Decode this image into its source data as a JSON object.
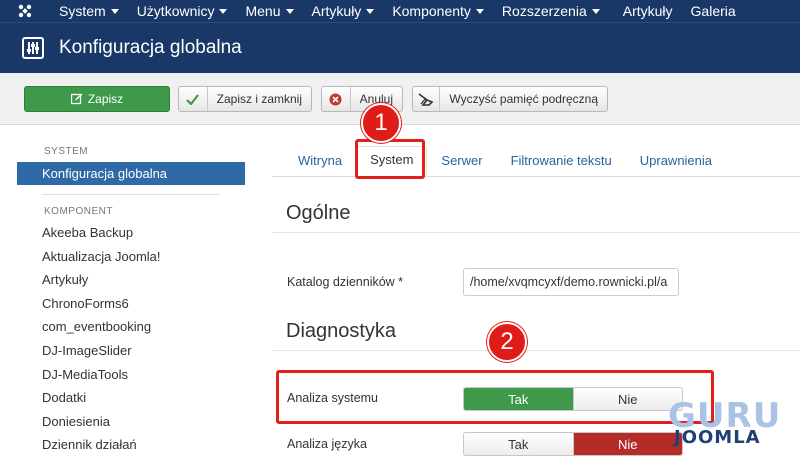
{
  "topnav": {
    "items": [
      {
        "label": "System",
        "caret": true
      },
      {
        "label": "Użytkownicy",
        "caret": true
      },
      {
        "label": "Menu",
        "caret": true
      },
      {
        "label": "Artykuły",
        "caret": true
      },
      {
        "label": "Komponenty",
        "caret": true
      },
      {
        "label": "Rozszerzenia",
        "caret": true
      },
      {
        "label": "Artykuły",
        "caret": false
      },
      {
        "label": "Galeria",
        "caret": false
      }
    ]
  },
  "page": {
    "title": "Konfiguracja globalna"
  },
  "toolbar": {
    "save_label": "Zapisz",
    "save_close_label": "Zapisz i zamknij",
    "cancel_label": "Anuluj",
    "clear_cache_label": "Wyczyść pamięć podręczną"
  },
  "sidebar": {
    "system_heading": "SYSTEM",
    "active_item": "Konfiguracja globalna",
    "component_heading": "KOMPONENT",
    "items": [
      "Akeeba Backup",
      "Aktualizacja Joomla!",
      "Artykuły",
      "ChronoForms6",
      "com_eventbooking",
      "DJ-ImageSlider",
      "DJ-MediaTools",
      "Dodatki",
      "Doniesienia",
      "Dziennik działań"
    ]
  },
  "tabs": [
    {
      "label": "Witryna",
      "active": false
    },
    {
      "label": "System",
      "active": true
    },
    {
      "label": "Serwer",
      "active": false
    },
    {
      "label": "Filtrowanie tekstu",
      "active": false
    },
    {
      "label": "Uprawnienia",
      "active": false
    }
  ],
  "sections": {
    "general_title": "Ogólne",
    "diagnostics_title": "Diagnostyka"
  },
  "fields": {
    "log_dir_label": "Katalog dzienników *",
    "log_dir_value": "/home/xvqmcyxf/demo.rownicki.pl/a",
    "system_debug_label": "Analiza systemu",
    "system_debug_yes": "Tak",
    "system_debug_no": "Nie",
    "system_debug_selected": "Tak",
    "lang_debug_label": "Analiza języka",
    "lang_debug_yes": "Tak",
    "lang_debug_no": "Nie",
    "lang_debug_selected": "Nie"
  },
  "annotations": {
    "badge1": "1",
    "badge2": "2"
  },
  "watermark": {
    "line1": "GURU",
    "line2": "JOOMLA"
  },
  "colors": {
    "nav_bg": "#1a3867",
    "save_green": "#3e9a4a",
    "active_blue": "#2f6aa6",
    "yes_green": "#3e9a4a",
    "no_red": "#b52b27",
    "highlight_red": "#e0201a"
  }
}
